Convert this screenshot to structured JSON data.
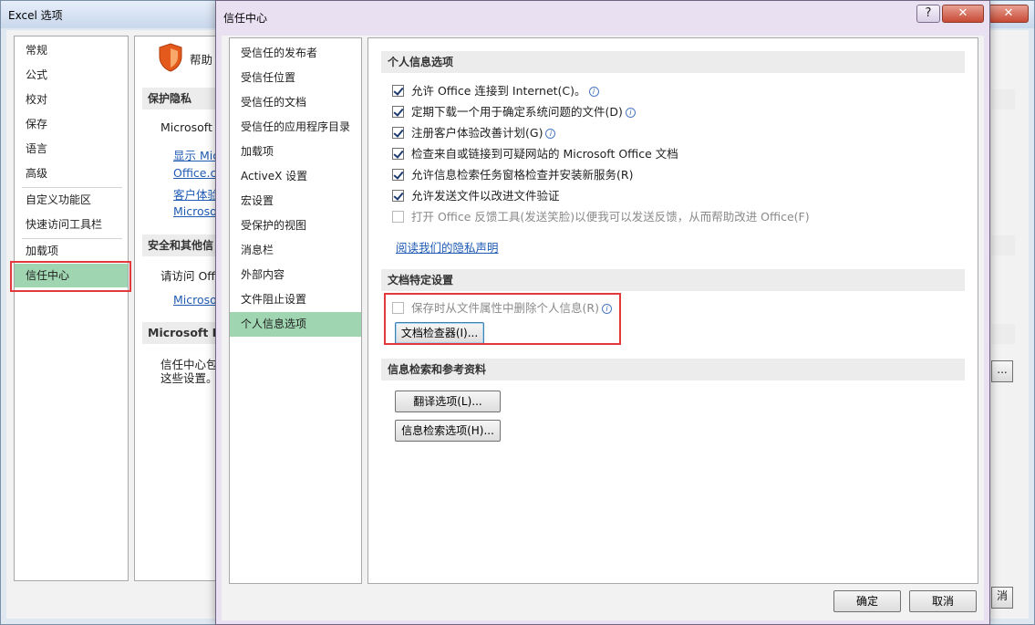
{
  "background_window": {
    "title": "Excel 选项",
    "close_glyph": "✕",
    "nav": [
      {
        "label": "常规",
        "selected": false
      },
      {
        "label": "公式",
        "selected": false
      },
      {
        "label": "校对",
        "selected": false
      },
      {
        "label": "保存",
        "selected": false
      },
      {
        "label": "语言",
        "selected": false
      },
      {
        "label": "高级",
        "selected": false
      },
      {
        "label": "自定义功能区",
        "selected": false
      },
      {
        "label": "快速访问工具栏",
        "selected": false
      },
      {
        "label": "加载项",
        "selected": false
      },
      {
        "label": "信任中心",
        "selected": true
      }
    ],
    "content": {
      "help_text": "帮助",
      "privacy_section": "保护隐私",
      "privacy_text": "Microsoft",
      "links": [
        "显示 Mic",
        "Office.co",
        "客户体验",
        "Microso"
      ],
      "security_section": "安全和其他信",
      "security_text": "请访问 Offi",
      "security_link": "Microso",
      "trust_section": "Microsoft E",
      "trust_text_1": "信任中心包",
      "trust_text_2": "这些设置。"
    },
    "right_button_glyph": "...",
    "right_button_2_glyph": "消"
  },
  "dialog": {
    "title": "信任中心",
    "help_glyph": "?",
    "close_glyph": "✕",
    "nav": [
      {
        "label": "受信任的发布者",
        "selected": false
      },
      {
        "label": "受信任位置",
        "selected": false
      },
      {
        "label": "受信任的文档",
        "selected": false
      },
      {
        "label": "受信任的应用程序目录",
        "selected": false
      },
      {
        "label": "加载项",
        "selected": false
      },
      {
        "label": "ActiveX 设置",
        "selected": false
      },
      {
        "label": "宏设置",
        "selected": false
      },
      {
        "label": "受保护的视图",
        "selected": false
      },
      {
        "label": "消息栏",
        "selected": false
      },
      {
        "label": "外部内容",
        "selected": false
      },
      {
        "label": "文件阻止设置",
        "selected": false
      },
      {
        "label": "个人信息选项",
        "selected": true
      }
    ],
    "personal_section": {
      "title": "个人信息选项",
      "options": [
        {
          "label": "允许 Office 连接到 Internet(C)。",
          "checked": true,
          "info": true,
          "disabled": false
        },
        {
          "label": "定期下载一个用于确定系统问题的文件(D)",
          "checked": true,
          "info": true,
          "disabled": false
        },
        {
          "label": "注册客户体验改善计划(G)",
          "checked": true,
          "info": true,
          "disabled": false
        },
        {
          "label": "检查来自或链接到可疑网站的 Microsoft Office 文档",
          "checked": true,
          "info": false,
          "disabled": false
        },
        {
          "label": "允许信息检索任务窗格检查并安装新服务(R)",
          "checked": true,
          "info": false,
          "disabled": false
        },
        {
          "label": "允许发送文件以改进文件验证",
          "checked": true,
          "info": false,
          "disabled": false
        },
        {
          "label": "打开 Office 反馈工具(发送笑脸)以便我可以发送反馈，从而帮助改进 Office(F)",
          "checked": false,
          "info": false,
          "disabled": true
        }
      ],
      "privacy_link": "阅读我们的隐私声明"
    },
    "document_section": {
      "title": "文档特定设置",
      "option": {
        "label": "保存时从文件属性中删除个人信息(R)",
        "checked": false,
        "info": true,
        "disabled": true
      },
      "inspector_button": "文档检查器(I)..."
    },
    "research_section": {
      "title": "信息检索和参考资料",
      "translate_button": "翻译选项(L)...",
      "research_button": "信息检索选项(H)..."
    },
    "footer": {
      "ok": "确定",
      "cancel": "取消"
    },
    "info_glyph": "i"
  },
  "colors": {
    "selected_nav": "#9fd5b0",
    "highlight_box": "#e23a3a",
    "link": "#1f5bb4"
  }
}
